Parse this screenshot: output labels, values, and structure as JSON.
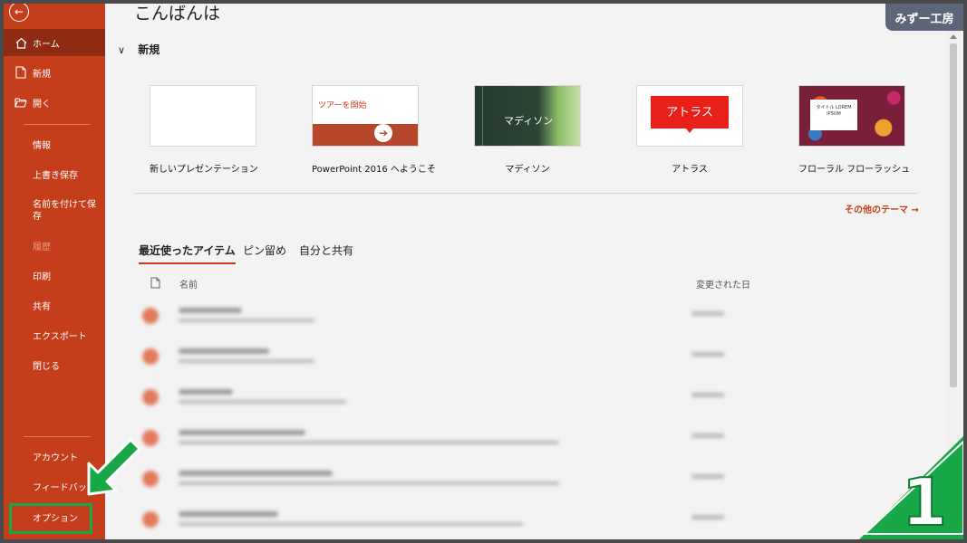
{
  "sidebar": {
    "home": "ホーム",
    "new": "新規",
    "open": "開く",
    "info": "情報",
    "save": "上書き保存",
    "save_as": "名前を付けて保存",
    "history": "履歴",
    "print": "印刷",
    "share": "共有",
    "export": "エクスポート",
    "close": "閉じる",
    "account": "アカウント",
    "feedback": "フィードバック",
    "options": "オプション"
  },
  "main": {
    "greeting": "こんばんは",
    "new_section": "新規",
    "templates": [
      {
        "name": "新しいプレゼンテーション"
      },
      {
        "name": "PowerPoint 2016 へようこそ",
        "thumb_text": "ツアーを開始"
      },
      {
        "name": "マディソン",
        "thumb_text": "マディソン"
      },
      {
        "name": "アトラス",
        "thumb_text": "アトラス"
      },
      {
        "name": "フローラル フローラッシュ",
        "thumb_text": "タイトル LOREM IPSUM"
      }
    ],
    "more_themes": "その他のテーマ →",
    "tabs": [
      "最近使ったアイテム",
      "ピン留め",
      "自分と共有"
    ],
    "columns": {
      "name": "名前",
      "modified": "変更された日"
    }
  },
  "overlay": {
    "watermark": "みずー工房",
    "step_number": "1"
  },
  "colors": {
    "accent": "#c43e1c",
    "accent_dark": "#8f2b12",
    "highlight_green": "#18a847"
  }
}
